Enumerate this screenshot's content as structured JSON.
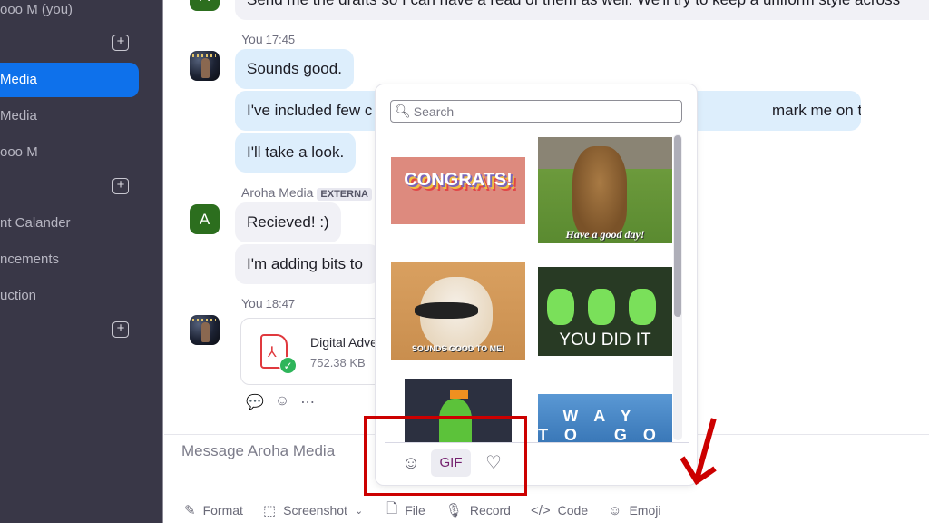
{
  "sidebar": {
    "items": [
      {
        "label": "ooo M (you)",
        "active": false
      },
      {
        "label": "Media",
        "active": true
      },
      {
        "label": "Media",
        "active": false
      },
      {
        "label": "ooo M",
        "active": false
      },
      {
        "label": "nt Calander",
        "active": false
      },
      {
        "label": "ncements",
        "active": false
      },
      {
        "label": "uction",
        "active": false
      }
    ],
    "add_icon": "+",
    "accent_color": "#0e71eb"
  },
  "chat": {
    "messages": {
      "top_partial": {
        "text": "Send me the drafts so I can have a read of them as well. We'll try to keep a uniform style across",
        "avatar_letter": "A"
      },
      "you_1745": {
        "sender": "You",
        "time": "17:45",
        "bubbles": [
          "Sounds good.",
          "I've included few c",
          "mark me on the card.",
          "I'll take a look."
        ]
      },
      "aroha": {
        "sender": "Aroha Media",
        "badge": "EXTERNA",
        "avatar_letter": "A",
        "bubbles": [
          "Recieved! :)",
          "I'm adding bits to"
        ]
      },
      "you_1847": {
        "sender": "You",
        "time": "18:47",
        "file": {
          "name": "Digital Adve",
          "size": "752.38 KB"
        }
      }
    },
    "message_actions": [
      "reply-icon",
      "add-reaction-icon",
      "more-icon"
    ],
    "composer": {
      "placeholder": "Message Aroha Media"
    },
    "toolbar": [
      {
        "label": "Format",
        "icon": "format-icon"
      },
      {
        "label": "Screenshot",
        "icon": "screenshot-icon",
        "has_dropdown": true
      },
      {
        "label": "File",
        "icon": "file-icon"
      },
      {
        "label": "Record",
        "icon": "microphone-icon"
      },
      {
        "label": "Code",
        "icon": "code-icon"
      },
      {
        "label": "Emoji",
        "icon": "emoji-icon"
      }
    ]
  },
  "picker": {
    "search_placeholder": "Search",
    "gifs": [
      {
        "name": "congrats",
        "caption": "CONGRATS!"
      },
      {
        "name": "bear",
        "caption": "Have a good day!"
      },
      {
        "name": "cat",
        "caption": "SOUNDS GOOD TO ME!"
      },
      {
        "name": "flowers",
        "caption": "YOU DID IT"
      },
      {
        "name": "pickle",
        "caption": ""
      },
      {
        "name": "peanut",
        "caption": "WAY TO GO"
      }
    ],
    "tabs": [
      {
        "name": "emoji",
        "label": "☺",
        "active": false
      },
      {
        "name": "gif",
        "label": "GIF",
        "active": true
      },
      {
        "name": "favorites",
        "label": "♡",
        "active": false
      }
    ]
  },
  "annotations": {
    "highlight_color": "#cc0000"
  }
}
